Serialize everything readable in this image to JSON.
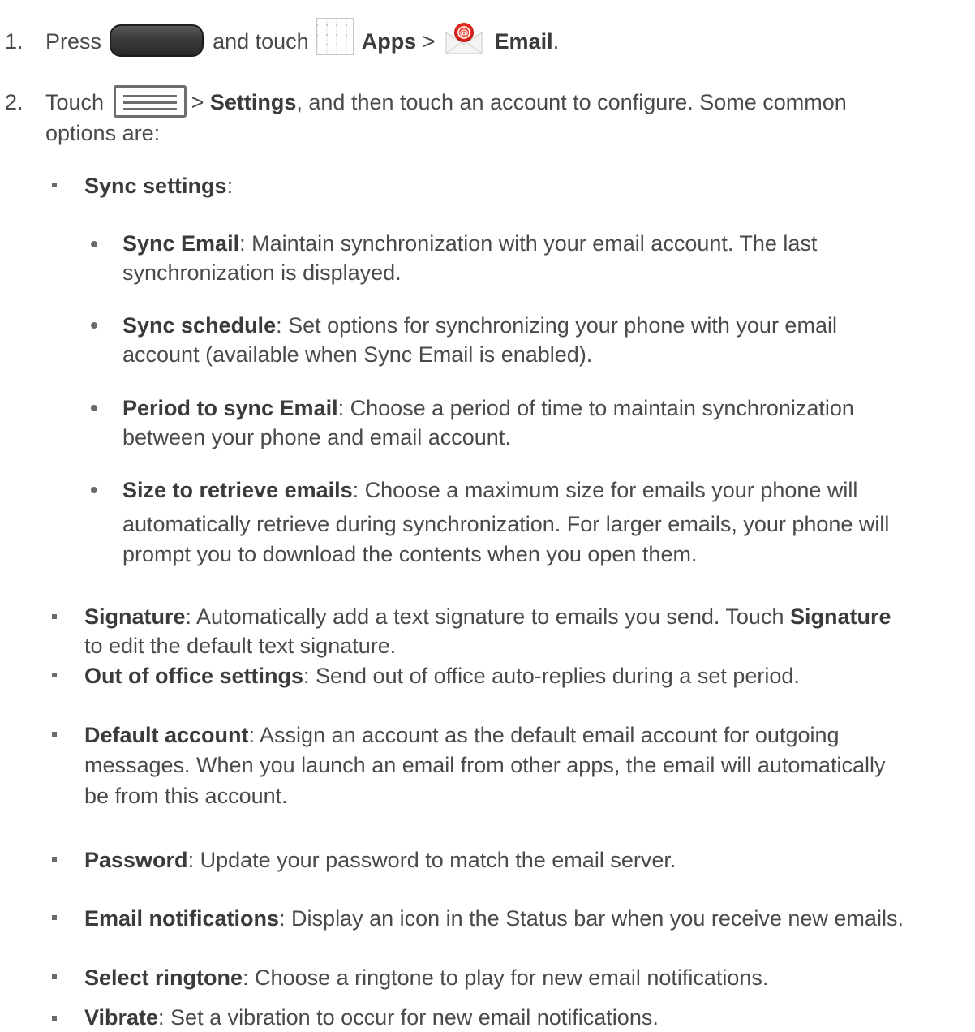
{
  "step1": {
    "number": "1.",
    "press": "Press",
    "and_touch": "and touch",
    "apps": "Apps",
    "sep": ">",
    "email": "Email",
    "period": "."
  },
  "step2": {
    "number": "2.",
    "touch": "Touch",
    "sep": ">",
    "settings": "Settings",
    "rest_line1": ", and then touch an account to configure. Some common",
    "rest_line2": "options are:"
  },
  "sync_settings": {
    "title": "Sync settings",
    "colon": ":"
  },
  "sync_items": [
    {
      "title": "Sync Email",
      "l1": ": Maintain synchronization with your email account. The last",
      "l2": "synchronization is displayed."
    },
    {
      "title": "Sync schedule",
      "l1": ": Set options for synchronizing your phone with your email",
      "l2": "account (available when Sync Email is enabled)."
    },
    {
      "title": "Period to sync Email",
      "l1": ": Choose a period of time to maintain synchronization",
      "l2": "between your phone and email account."
    },
    {
      "title": "Size to retrieve emails",
      "l1": ": Choose a maximum size for emails your phone will",
      "l2": "automatically retrieve during synchronization. For larger emails, your phone will",
      "l3": "prompt you to download the contents when you open them."
    }
  ],
  "signature": {
    "title": "Signature",
    "l1": ": Automatically add a text signature to emails you send. Touch ",
    "bold2": "Signature",
    "l2": "to edit the default text signature."
  },
  "out_of_office": {
    "title": "Out of office settings",
    "l1": ": Send out of office auto-replies during a set period."
  },
  "default_account": {
    "title": "Default account",
    "l1": ": Assign an account as the default email account for outgoing",
    "l2": "messages. When you launch an email from other apps, the email will automatically",
    "l3": "be from this account."
  },
  "password": {
    "title": "Password",
    "l1": ": Update your password to match the email server."
  },
  "email_notifications": {
    "title": "Email notifications",
    "l1": ": Display an icon in the Status bar when you receive new emails."
  },
  "select_ringtone": {
    "title": "Select ringtone",
    "l1": ": Choose a ringtone to play for new email notifications."
  },
  "vibrate": {
    "title": "Vibrate",
    "l1": ": Set a vibration to occur for new email notifications."
  },
  "icons": {
    "home": "home-button-icon",
    "apps": "apps-grid-icon",
    "email": "email-app-icon",
    "menu": "menu-key-icon"
  }
}
